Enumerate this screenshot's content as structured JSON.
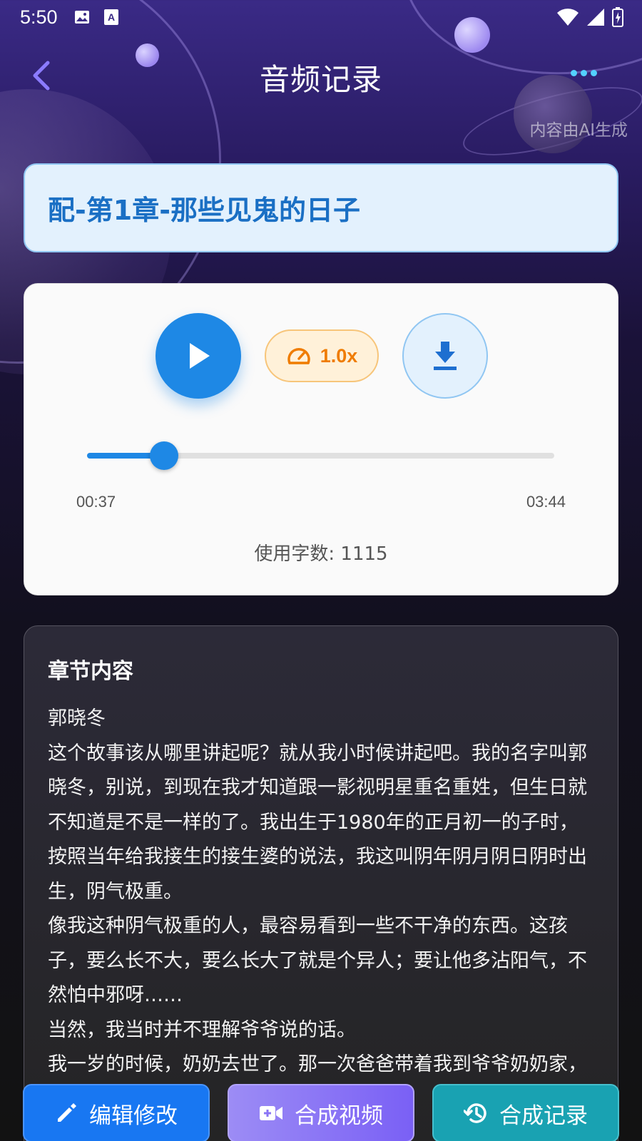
{
  "status_bar": {
    "time": "5:50",
    "icons": [
      "image-icon",
      "text-a-icon",
      "wifi-icon",
      "signal-icon",
      "battery-icon"
    ]
  },
  "header": {
    "title": "音频记录",
    "ai_note": "内容由AI生成",
    "icons": [
      "chevron-left-icon",
      "more-dots-icon"
    ]
  },
  "chapter": {
    "title": "配-第1章-那些见鬼的日子"
  },
  "player": {
    "speed_label": "1.0x",
    "current_time": "00:37",
    "total_time": "03:44",
    "progress": 0.165,
    "word_count_label": "使用字数: 1115"
  },
  "content": {
    "heading": "章节内容",
    "paragraphs": [
      "郭晓冬",
      "这个故事该从哪里讲起呢？就从我小时候讲起吧。我的名字叫郭晓冬，别说，到现在我才知道跟一影视明星重名重姓，但生日就不知道是不是一样的了。我出生于1980年的正月初一的子时，按照当年给我接生的接生婆的说法，我这叫阴年阴月阴日阴时出生，阴气极重。",
      "像我这种阴气极重的人，最容易看到一些不干净的东西。这孩子，要么长不大，要么长大了就是个异人；要让他多沾阳气，不然怕中邪呀……",
      "当然，我当时并不理解爷爷说的话。",
      "我一岁的时候，奶奶去世了。那一次爸爸带着我到爷爷奶奶家，"
    ]
  },
  "bottom_bar": {
    "edit_label": "编辑修改",
    "video_label": "合成视频",
    "history_label": "合成记录"
  },
  "colors": {
    "accent_blue": "#1e88e5",
    "speed_orange": "#ef7c00",
    "edit_button": "#1877f2",
    "video_button": "#8a74f5",
    "history_button": "#19a2b2"
  }
}
